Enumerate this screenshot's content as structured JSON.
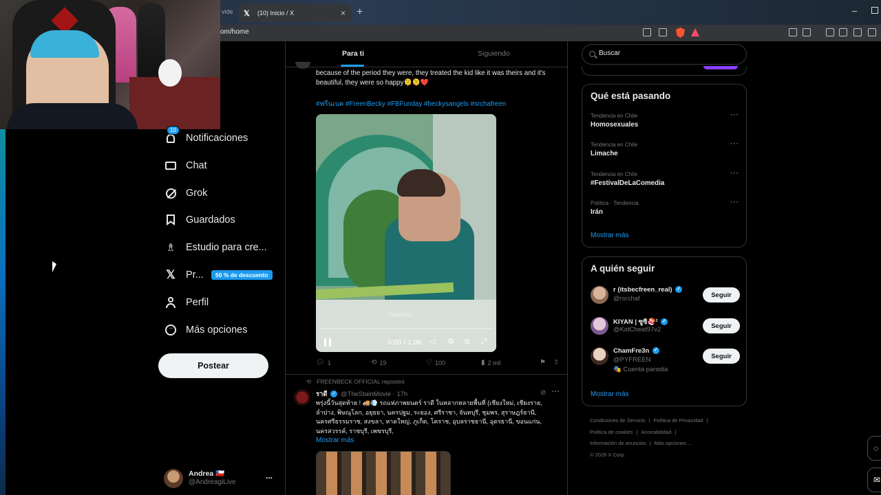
{
  "browser": {
    "prev_tab_fragment": "vide",
    "tab_title": "(10) Inicio / X",
    "url": "om/home"
  },
  "nav": {
    "notifications": {
      "label": "Notificaciones",
      "badge": "10"
    },
    "chat": "Chat",
    "grok": "Grok",
    "saved": "Guardados",
    "studio": "Estudio para cre...",
    "premium": {
      "label": "Pr...",
      "badge": "50 % de descuento"
    },
    "profile": "Perfil",
    "more": "Más opciones",
    "post_button": "Postear"
  },
  "account": {
    "name": "Andrea 🇨🇱",
    "handle": "@AndreagiLive",
    "more": "..."
  },
  "feed": {
    "tabs": [
      "Para ti",
      "Siguiendo"
    ],
    "tweet1": {
      "text": "because of the period they were, they treated the kid like it was theirs and it's beautiful, they were so happy🫠🫠❤️",
      "hashtags": "#ฟรีนเบค #FreenBecky #FBFunday #beckysangels #srchafreen",
      "video_time": "0:00 / 1:06",
      "watermark": "FB♥BABE",
      "replies": "1",
      "reposts": "19",
      "likes": "100",
      "views": "2 mil"
    },
    "tweet2": {
      "reposted_by": "FREENBECK OFFICIAL reposteó",
      "name": "ราดี",
      "handle": "@TheStainMovie",
      "time": "· 17h",
      "text": "พรุ่งนี้วันสุดท้าย ! 🚚💨 รถแห่ภาพยนตร์ ราดี ในหลากหลายพื้นที่ (เชียงใหม่, เชียงราย, ลำปาง, พิษณุโลก, อยุธยา, นครปฐม, ระยอง, ศรีราชา, จันทบุรี, ชุมพร, สุราษฎร์ธานี, นครศรีธรรมราช, สงขลา, หาดใหญ่, ภูเก็ต, โคราช, อุบลราชธานี, อุดรธานี, ขอนแก่น, นครสวรรค์, ราชบุรี, เพชรบุรี,",
      "show_more": "Mostrar más"
    }
  },
  "search": {
    "placeholder": "Buscar"
  },
  "trending": {
    "title": "Qué está pasando",
    "items": [
      {
        "meta": "Tendencia en Chile",
        "name": "Homosexuales"
      },
      {
        "meta": "Tendencia en Chile",
        "name": "Limache"
      },
      {
        "meta": "Tendencia en Chile",
        "name": "#FestivalDeLaComedia"
      },
      {
        "meta": "Política · Tendencia",
        "name": "Irán"
      }
    ],
    "show_more": "Mostrar más"
  },
  "who_to_follow": {
    "title": "A quién seguir",
    "users": [
      {
        "name": "r (itsbecfreen_real)",
        "handle": "@rsrchaf",
        "extra": "",
        "button": "Seguir"
      },
      {
        "name": "KIYAN | ซูซิ🍣²",
        "handle": "@KidCheat97v2",
        "extra": "",
        "button": "Seguir"
      },
      {
        "name": "ChamFre3n",
        "handle": "@PYFREEN",
        "extra": "🎭 Cuenta parodia",
        "button": "Seguir"
      }
    ],
    "show_more": "Mostrar más"
  },
  "footer": {
    "terms": "Condiciones de Servicio",
    "privacy": "Política de Privacidad",
    "cookies": "Política de cookies",
    "accessibility": "Accesibilidad",
    "ads": "Información de anuncios",
    "more": "Más opciones ...",
    "copyright": "© 2026 X Corp."
  },
  "colors": {
    "accent": "#1d9bf0",
    "background": "#000000",
    "border": "#2f3336",
    "muted": "#71767b"
  }
}
